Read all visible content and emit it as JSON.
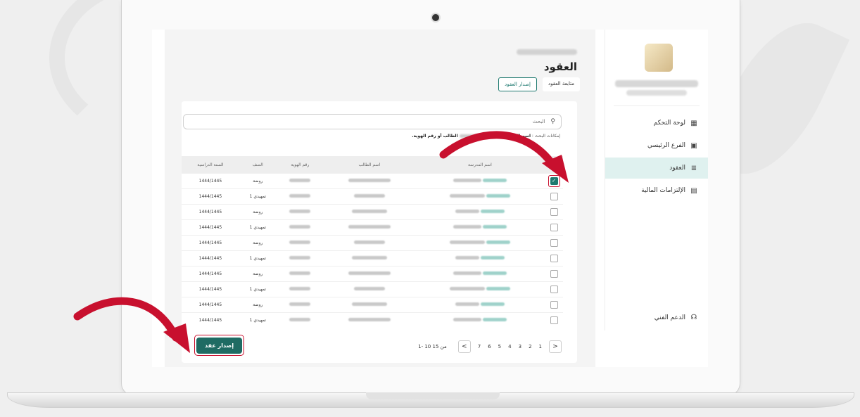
{
  "sidebar": {
    "items": [
      {
        "label": "لوحة التحكم",
        "icon": "dashboard-icon",
        "glyph": "▦"
      },
      {
        "label": "الفرع الرئيسي",
        "icon": "branch-icon",
        "glyph": "▣"
      },
      {
        "label": "العقود",
        "icon": "contracts-icon",
        "glyph": "≣"
      },
      {
        "label": "الإلتزامات المالية",
        "icon": "finance-icon",
        "glyph": "▤"
      }
    ],
    "support": {
      "label": "الدعم الفني",
      "glyph": "☊"
    }
  },
  "page": {
    "title": "العقود",
    "tabs": {
      "follow": "متابعة العقود",
      "issue": "إصدار العقود"
    }
  },
  "search": {
    "placeholder": "البحث",
    "hint_prefix": "إمكانات البحث :",
    "hint_terms": "اسم المدرسة",
    "hint_suffix": "الطالب أو رقم الهوية."
  },
  "table": {
    "headers": [
      "اسم المدرسة",
      "اسم الطالب",
      "رقم الهوية",
      "الصف",
      "السنة الدراسية"
    ],
    "rows": [
      {
        "grade": "روضة",
        "year": "1444/1445",
        "checked": true
      },
      {
        "grade": "تمهيدي 1",
        "year": "1444/1445",
        "checked": false
      },
      {
        "grade": "روضة",
        "year": "1444/1445",
        "checked": false
      },
      {
        "grade": "تمهيدي 1",
        "year": "1444/1445",
        "checked": false
      },
      {
        "grade": "روضة",
        "year": "1444/1445",
        "checked": false
      },
      {
        "grade": "تمهيدي 1",
        "year": "1444/1445",
        "checked": false
      },
      {
        "grade": "روضة",
        "year": "1444/1445",
        "checked": false
      },
      {
        "grade": "تمهيدي 1",
        "year": "1444/1445",
        "checked": false
      },
      {
        "grade": "روضة",
        "year": "1444/1445",
        "checked": false
      },
      {
        "grade": "تمهيدي 1",
        "year": "1444/1445",
        "checked": false
      }
    ]
  },
  "pagination": {
    "range": "1- 10 من 15",
    "pages": [
      "1",
      "2",
      "3",
      "4",
      "5",
      "6",
      "7"
    ],
    "prev_glyph": "<",
    "next_glyph": ">"
  },
  "actions": {
    "issue_contract": "إصدار عقد"
  },
  "colors": {
    "accent": "#1f6b63",
    "annotation": "#c8102e"
  }
}
